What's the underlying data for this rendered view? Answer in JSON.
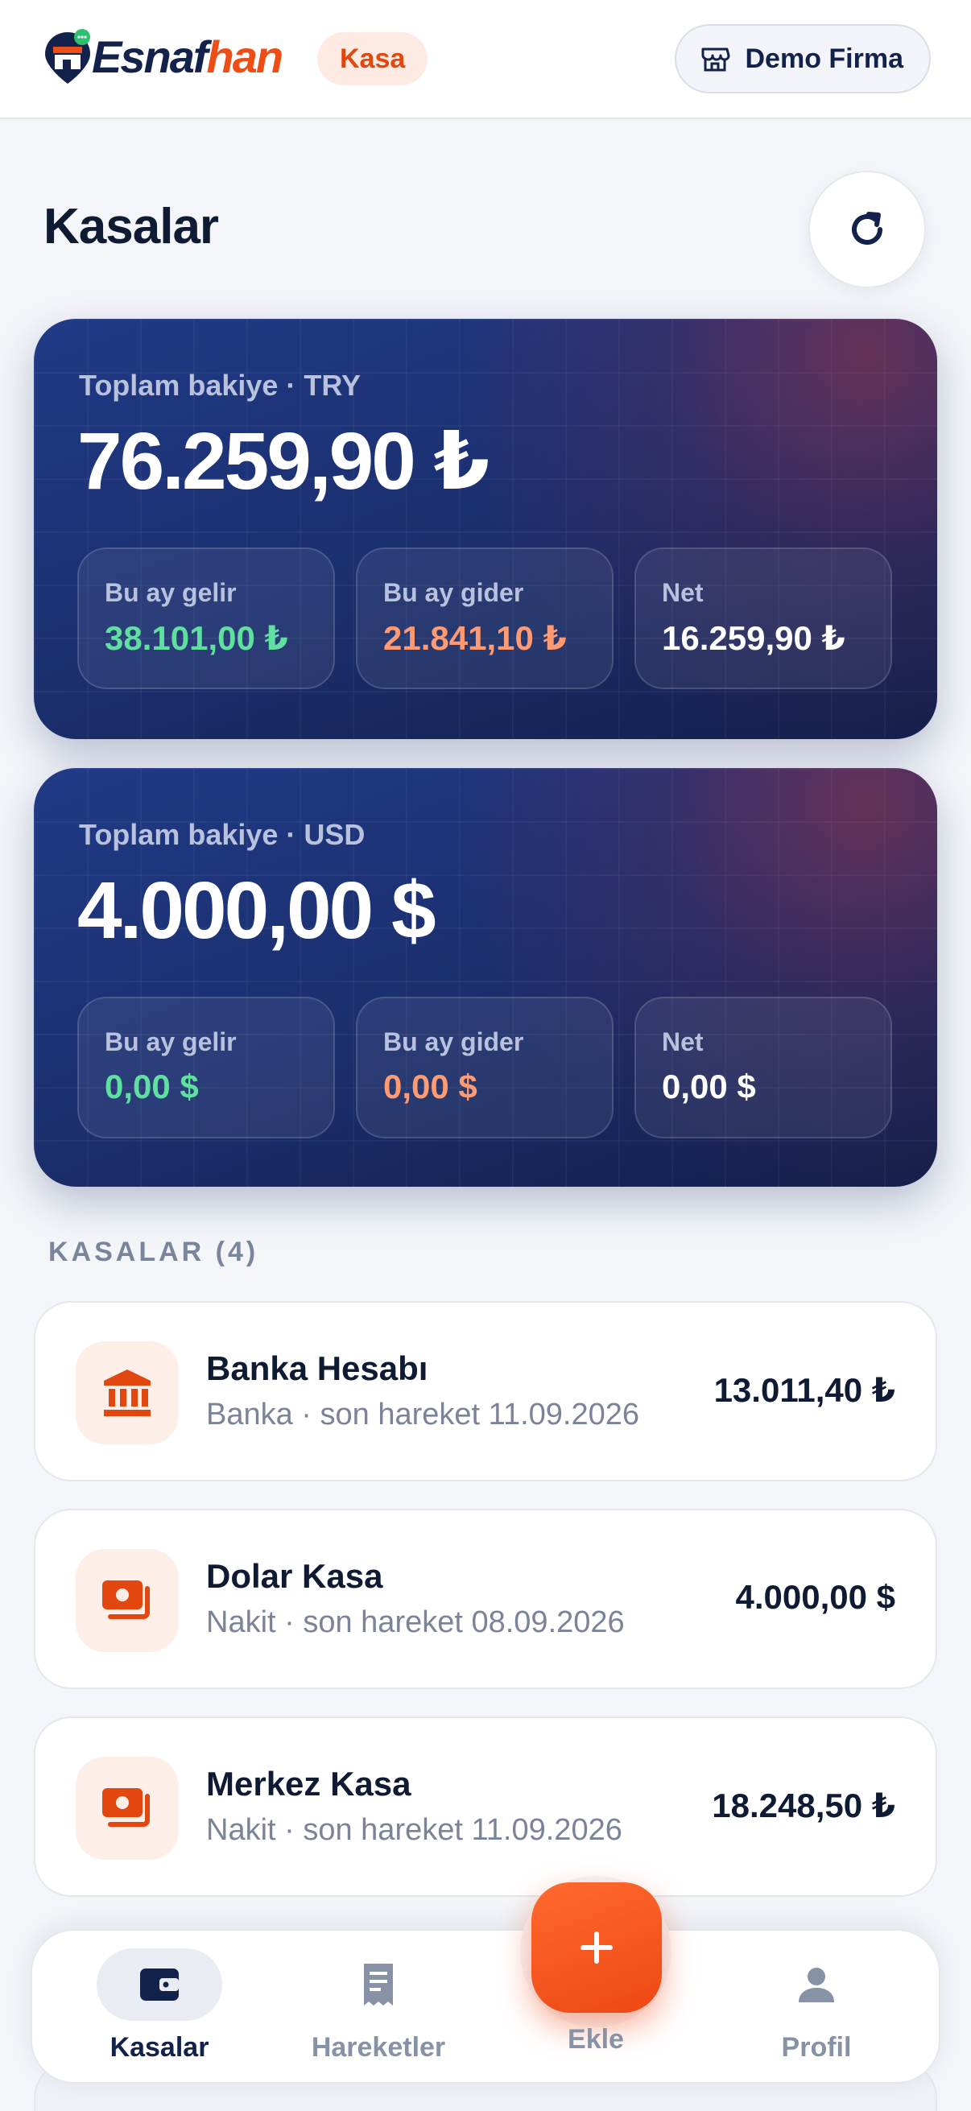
{
  "header": {
    "logo_text_a": "Esnaf",
    "logo_text_b": "han",
    "section_badge": "Kasa",
    "company_button": "Demo Firma"
  },
  "page": {
    "title": "Kasalar",
    "refresh_icon": "refresh-icon"
  },
  "balances": [
    {
      "label": "Toplam bakiye · TRY",
      "amount": "76.259,90 ₺",
      "income_label": "Bu ay gelir",
      "income_value": "38.101,00 ₺",
      "expense_label": "Bu ay gider",
      "expense_value": "21.841,10 ₺",
      "net_label": "Net",
      "net_value": "16.259,90 ₺"
    },
    {
      "label": "Toplam bakiye · USD",
      "amount": "4.000,00 $",
      "income_label": "Bu ay gelir",
      "income_value": "0,00 $",
      "expense_label": "Bu ay gider",
      "expense_value": "0,00 $",
      "net_label": "Net",
      "net_value": "0,00 $"
    }
  ],
  "accounts_section": {
    "label": "KASALAR (4)"
  },
  "accounts": [
    {
      "name": "Banka Hesabı",
      "subtitle": "Banka · son hareket 11.09.2026",
      "amount": "13.011,40 ₺",
      "icon": "bank-icon"
    },
    {
      "name": "Dolar Kasa",
      "subtitle": "Nakit · son hareket 08.09.2026",
      "amount": "4.000,00 $",
      "icon": "cash-icon"
    },
    {
      "name": "Merkez Kasa",
      "subtitle": "Nakit · son hareket 11.09.2026",
      "amount": "18.248,50 ₺",
      "icon": "cash-icon"
    }
  ],
  "nav": {
    "items": [
      {
        "label": "Kasalar",
        "icon": "wallet-icon",
        "active": true
      },
      {
        "label": "Hareketler",
        "icon": "receipt-icon",
        "active": false
      },
      {
        "label": "Ekle",
        "icon": "plus-icon",
        "active": false
      },
      {
        "label": "Profil",
        "icon": "person-icon",
        "active": false
      }
    ]
  },
  "colors": {
    "brand_orange": "#ee4d16",
    "navy": "#12224a",
    "income_green": "#5fe0a0",
    "expense_orange": "#ff9a72"
  }
}
